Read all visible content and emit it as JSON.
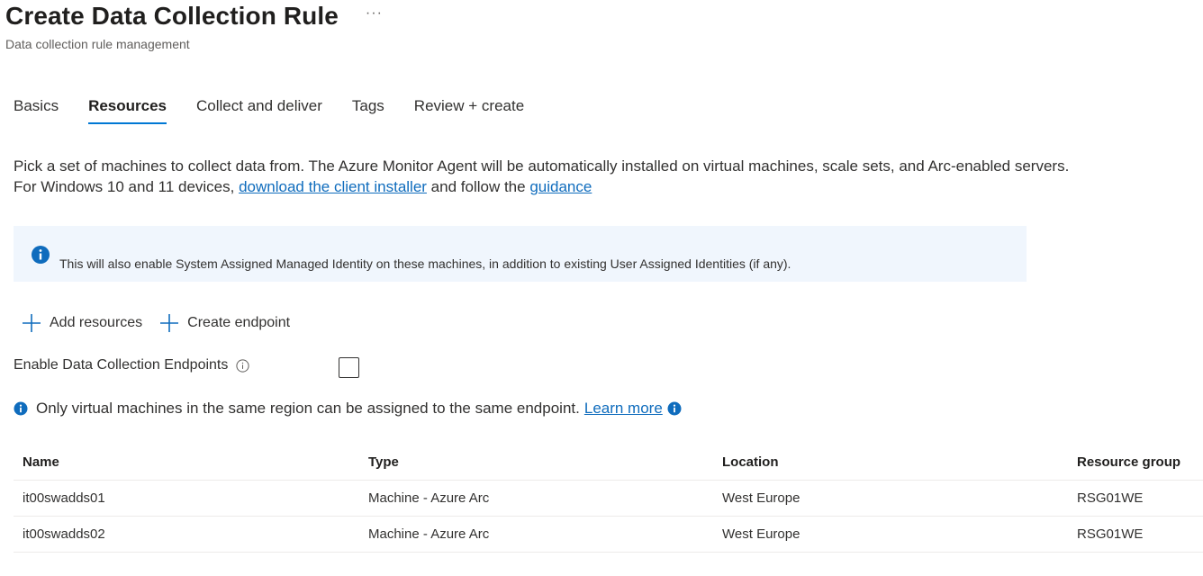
{
  "header": {
    "title": "Create Data Collection Rule",
    "more": "···",
    "subtitle": "Data collection rule management"
  },
  "tabs": [
    {
      "label": "Basics",
      "active": false
    },
    {
      "label": "Resources",
      "active": true
    },
    {
      "label": "Collect and deliver",
      "active": false
    },
    {
      "label": "Tags",
      "active": false
    },
    {
      "label": "Review + create",
      "active": false
    }
  ],
  "description": {
    "line1": "Pick a set of machines to collect data from. The Azure Monitor Agent will be automatically installed on virtual machines, scale sets, and Arc-enabled servers.",
    "line2_prefix": "For Windows 10 and 11 devices, ",
    "link1": "download the client installer",
    "line2_middle": " and follow the ",
    "link2": "guidance"
  },
  "info_box": {
    "text": "This will also enable System Assigned Managed Identity on these machines, in addition to existing User Assigned Identities (if any).",
    "icon": "info-icon"
  },
  "actions": {
    "add_resources": "Add resources",
    "create_endpoint": "Create endpoint"
  },
  "endpoints": {
    "label": "Enable Data Collection Endpoints",
    "checked": false
  },
  "note": {
    "text": "Only virtual machines in the same region can be assigned to the same endpoint.",
    "link": "Learn more"
  },
  "table": {
    "headers": [
      "Name",
      "Type",
      "Location",
      "Resource group"
    ],
    "rows": [
      [
        "it00swadds01",
        "Machine - Azure Arc",
        "West Europe",
        "RSG01WE"
      ],
      [
        "it00swadds02",
        "Machine - Azure Arc",
        "West Europe",
        "RSG01WE"
      ]
    ]
  },
  "colors": {
    "accent": "#0078d4",
    "link": "#0f6cbd",
    "info_bg": "#f0f6fd"
  }
}
